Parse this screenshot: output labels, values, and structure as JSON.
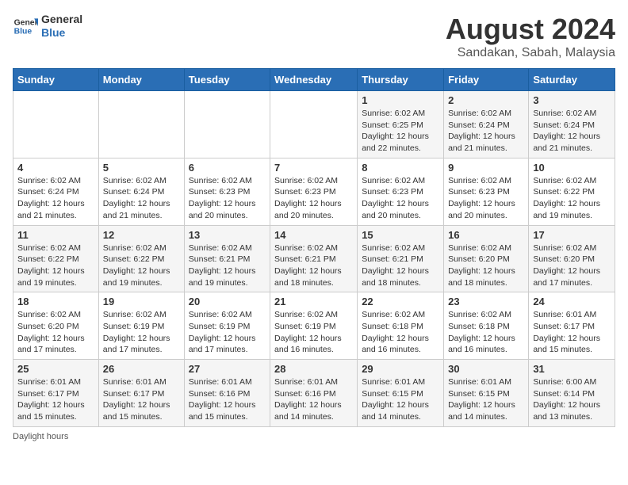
{
  "header": {
    "logo_line1": "General",
    "logo_line2": "Blue",
    "title": "August 2024",
    "subtitle": "Sandakan, Sabah, Malaysia"
  },
  "weekdays": [
    "Sunday",
    "Monday",
    "Tuesday",
    "Wednesday",
    "Thursday",
    "Friday",
    "Saturday"
  ],
  "weeks": [
    [
      {
        "day": "",
        "info": ""
      },
      {
        "day": "",
        "info": ""
      },
      {
        "day": "",
        "info": ""
      },
      {
        "day": "",
        "info": ""
      },
      {
        "day": "1",
        "info": "Sunrise: 6:02 AM\nSunset: 6:25 PM\nDaylight: 12 hours and 22 minutes."
      },
      {
        "day": "2",
        "info": "Sunrise: 6:02 AM\nSunset: 6:24 PM\nDaylight: 12 hours and 21 minutes."
      },
      {
        "day": "3",
        "info": "Sunrise: 6:02 AM\nSunset: 6:24 PM\nDaylight: 12 hours and 21 minutes."
      }
    ],
    [
      {
        "day": "4",
        "info": "Sunrise: 6:02 AM\nSunset: 6:24 PM\nDaylight: 12 hours and 21 minutes."
      },
      {
        "day": "5",
        "info": "Sunrise: 6:02 AM\nSunset: 6:24 PM\nDaylight: 12 hours and 21 minutes."
      },
      {
        "day": "6",
        "info": "Sunrise: 6:02 AM\nSunset: 6:23 PM\nDaylight: 12 hours and 20 minutes."
      },
      {
        "day": "7",
        "info": "Sunrise: 6:02 AM\nSunset: 6:23 PM\nDaylight: 12 hours and 20 minutes."
      },
      {
        "day": "8",
        "info": "Sunrise: 6:02 AM\nSunset: 6:23 PM\nDaylight: 12 hours and 20 minutes."
      },
      {
        "day": "9",
        "info": "Sunrise: 6:02 AM\nSunset: 6:23 PM\nDaylight: 12 hours and 20 minutes."
      },
      {
        "day": "10",
        "info": "Sunrise: 6:02 AM\nSunset: 6:22 PM\nDaylight: 12 hours and 19 minutes."
      }
    ],
    [
      {
        "day": "11",
        "info": "Sunrise: 6:02 AM\nSunset: 6:22 PM\nDaylight: 12 hours and 19 minutes."
      },
      {
        "day": "12",
        "info": "Sunrise: 6:02 AM\nSunset: 6:22 PM\nDaylight: 12 hours and 19 minutes."
      },
      {
        "day": "13",
        "info": "Sunrise: 6:02 AM\nSunset: 6:21 PM\nDaylight: 12 hours and 19 minutes."
      },
      {
        "day": "14",
        "info": "Sunrise: 6:02 AM\nSunset: 6:21 PM\nDaylight: 12 hours and 18 minutes."
      },
      {
        "day": "15",
        "info": "Sunrise: 6:02 AM\nSunset: 6:21 PM\nDaylight: 12 hours and 18 minutes."
      },
      {
        "day": "16",
        "info": "Sunrise: 6:02 AM\nSunset: 6:20 PM\nDaylight: 12 hours and 18 minutes."
      },
      {
        "day": "17",
        "info": "Sunrise: 6:02 AM\nSunset: 6:20 PM\nDaylight: 12 hours and 17 minutes."
      }
    ],
    [
      {
        "day": "18",
        "info": "Sunrise: 6:02 AM\nSunset: 6:20 PM\nDaylight: 12 hours and 17 minutes."
      },
      {
        "day": "19",
        "info": "Sunrise: 6:02 AM\nSunset: 6:19 PM\nDaylight: 12 hours and 17 minutes."
      },
      {
        "day": "20",
        "info": "Sunrise: 6:02 AM\nSunset: 6:19 PM\nDaylight: 12 hours and 17 minutes."
      },
      {
        "day": "21",
        "info": "Sunrise: 6:02 AM\nSunset: 6:19 PM\nDaylight: 12 hours and 16 minutes."
      },
      {
        "day": "22",
        "info": "Sunrise: 6:02 AM\nSunset: 6:18 PM\nDaylight: 12 hours and 16 minutes."
      },
      {
        "day": "23",
        "info": "Sunrise: 6:02 AM\nSunset: 6:18 PM\nDaylight: 12 hours and 16 minutes."
      },
      {
        "day": "24",
        "info": "Sunrise: 6:01 AM\nSunset: 6:17 PM\nDaylight: 12 hours and 15 minutes."
      }
    ],
    [
      {
        "day": "25",
        "info": "Sunrise: 6:01 AM\nSunset: 6:17 PM\nDaylight: 12 hours and 15 minutes."
      },
      {
        "day": "26",
        "info": "Sunrise: 6:01 AM\nSunset: 6:17 PM\nDaylight: 12 hours and 15 minutes."
      },
      {
        "day": "27",
        "info": "Sunrise: 6:01 AM\nSunset: 6:16 PM\nDaylight: 12 hours and 15 minutes."
      },
      {
        "day": "28",
        "info": "Sunrise: 6:01 AM\nSunset: 6:16 PM\nDaylight: 12 hours and 14 minutes."
      },
      {
        "day": "29",
        "info": "Sunrise: 6:01 AM\nSunset: 6:15 PM\nDaylight: 12 hours and 14 minutes."
      },
      {
        "day": "30",
        "info": "Sunrise: 6:01 AM\nSunset: 6:15 PM\nDaylight: 12 hours and 14 minutes."
      },
      {
        "day": "31",
        "info": "Sunrise: 6:00 AM\nSunset: 6:14 PM\nDaylight: 12 hours and 13 minutes."
      }
    ]
  ],
  "footer": "Daylight hours"
}
